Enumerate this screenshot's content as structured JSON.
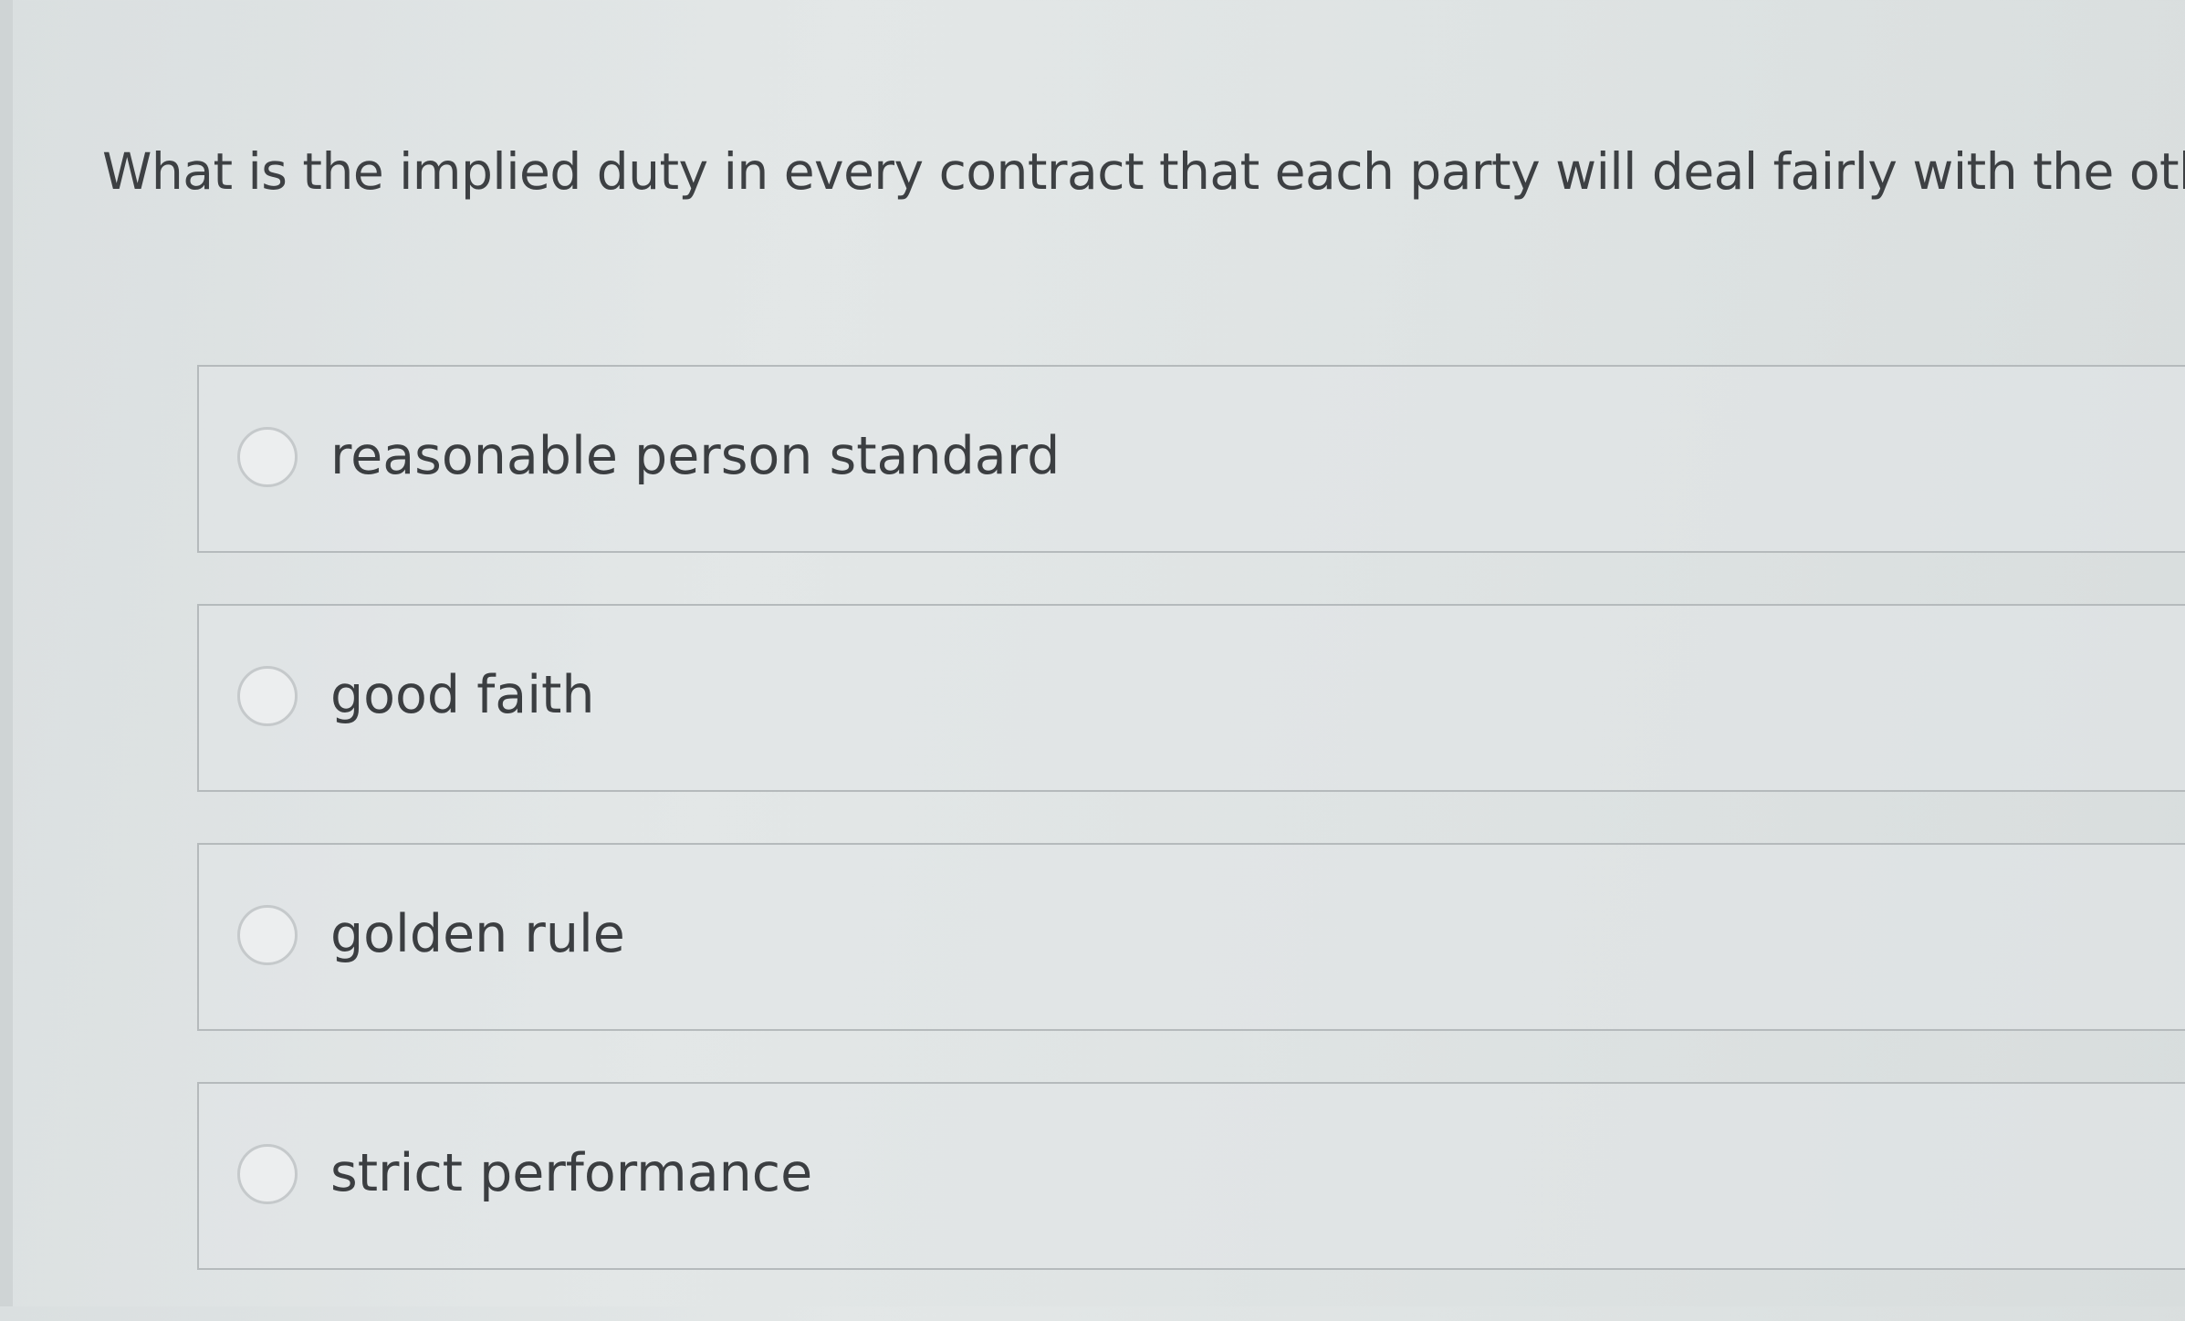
{
  "question": {
    "text": "What is the implied duty in every contract that each party will deal fairly with the other?"
  },
  "options": [
    {
      "label": "reasonable person standard",
      "selected": false
    },
    {
      "label": "good faith",
      "selected": false
    },
    {
      "label": "golden rule",
      "selected": false
    },
    {
      "label": "strict performance",
      "selected": false
    }
  ],
  "colors": {
    "background": "#e0e4e5",
    "text": "#3c3f42",
    "border": "#b5babc",
    "radio_border": "#c5c9cb"
  }
}
